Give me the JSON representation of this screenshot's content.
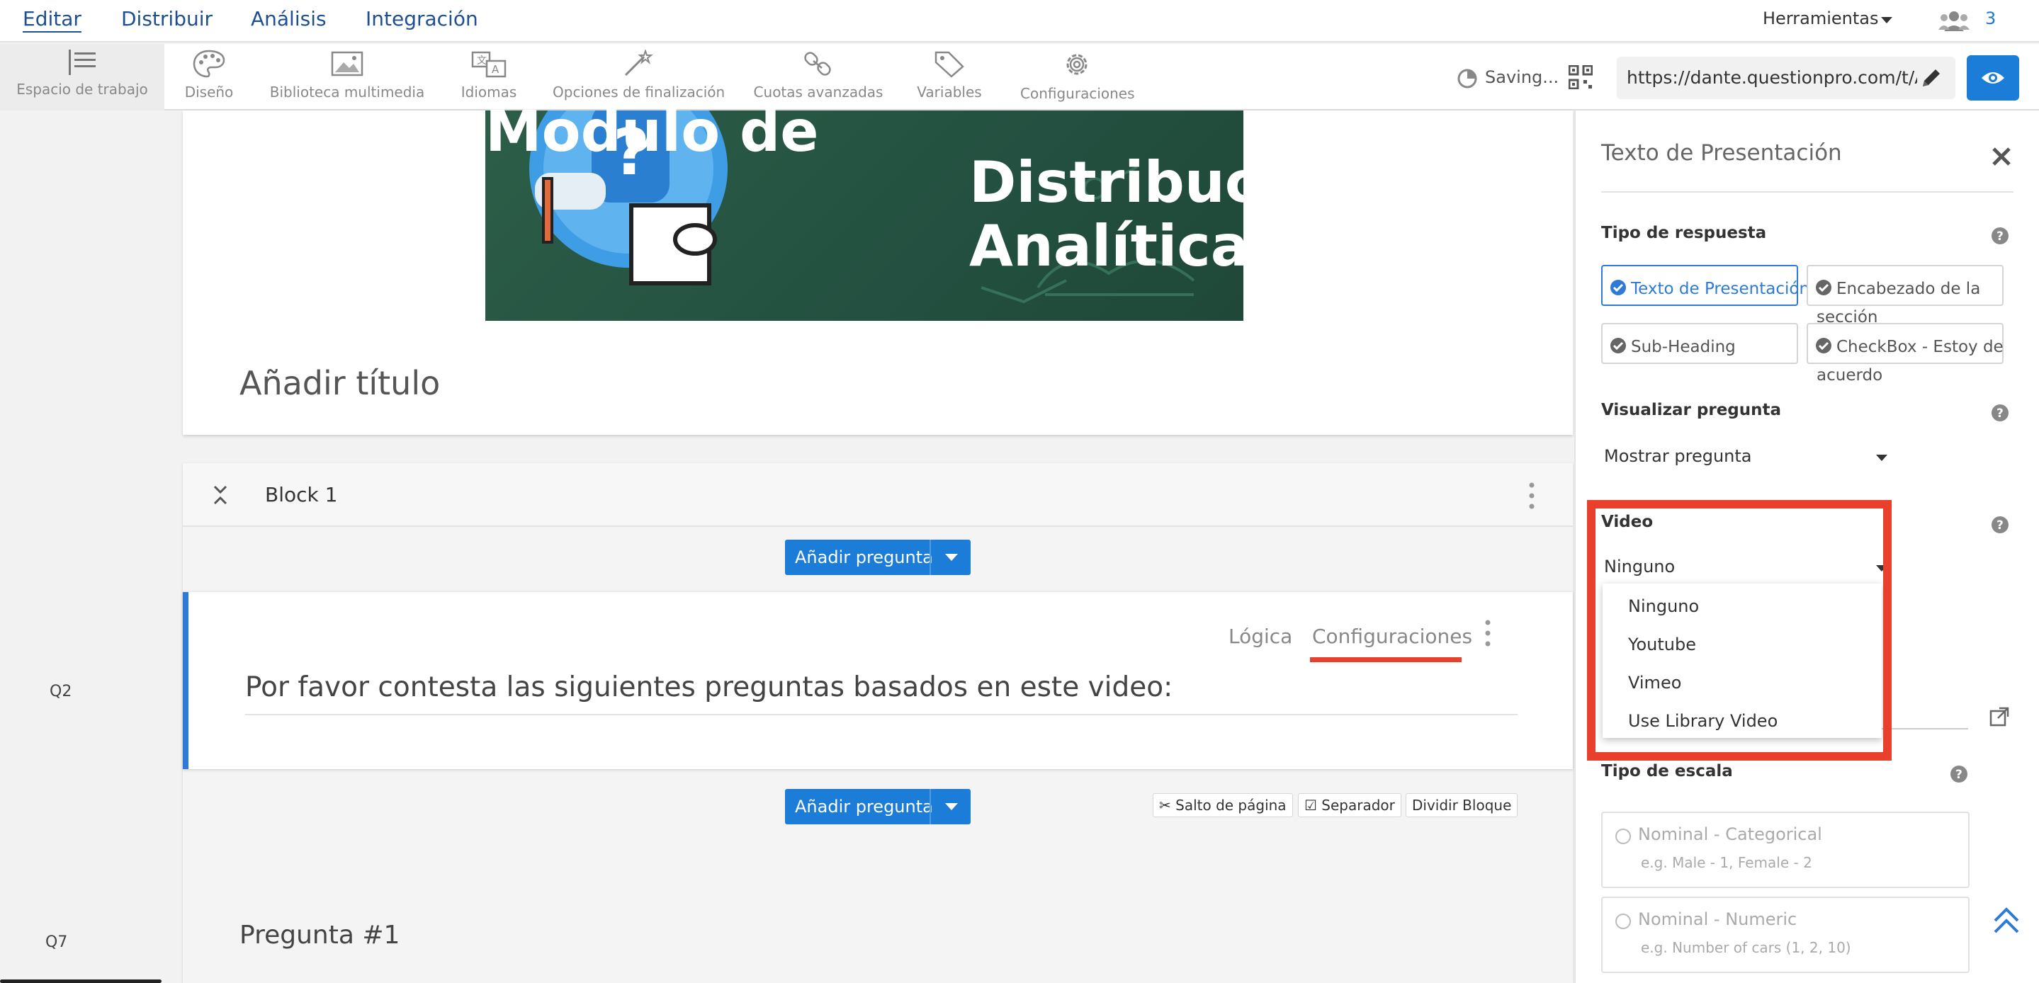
{
  "topnav": {
    "tabs": [
      "Editar",
      "Distribuir",
      "Análisis",
      "Integración"
    ],
    "tools_label": "Herramientas",
    "users_count": "3"
  },
  "toolbar": {
    "items": [
      "Espacio de trabajo",
      "Diseño",
      "Biblioteca multimedia",
      "Idiomas",
      "Opciones de finalización",
      "Cuotas avanzadas",
      "Variables",
      "Configuraciones"
    ],
    "saving": "Saving...",
    "url": "https://dante.questionpro.com/t/AS"
  },
  "gutter": {
    "q2": "Q2",
    "q7": "Q7"
  },
  "banner": {
    "lines": [
      "Modulo de",
      "Distribución y",
      "Analítica"
    ],
    "add_title": "Añadir título"
  },
  "block": {
    "title": "Block 1",
    "add_question": "Añadir pregunta",
    "question_links": [
      "Lógica",
      "Configuraciones"
    ],
    "question_text": "Por favor contesta las siguientes preguntas basados en este video:",
    "buttons": [
      "Salto de página",
      "Separador",
      "Dividir Bloque"
    ],
    "next_question": "Pregunta #1"
  },
  "panel": {
    "title": "Texto de Presentación",
    "response_type_heading": "Tipo de respuesta",
    "response_types": [
      "Texto de Presentación",
      "Encabezado de la sección",
      "Sub-Heading",
      "CheckBox - Estoy de acuerdo"
    ],
    "display_heading": "Visualizar pregunta",
    "display_value": "Mostrar pregunta",
    "video_heading": "Video",
    "video_value": "Ninguno",
    "video_options": [
      "Ninguno",
      "Youtube",
      "Vimeo",
      "Use Library Video"
    ],
    "scale_heading": "Tipo de escala",
    "scale_options": [
      {
        "title": "Nominal - Categorical",
        "subtitle": "e.g. Male - 1, Female - 2"
      },
      {
        "title": "Nominal - Numeric",
        "subtitle": "e.g. Number of cars (1, 2, 10)"
      }
    ]
  },
  "colors": {
    "accent": "#1b7dd8",
    "highlight": "#e8402c",
    "nav_text": "#1d4f91"
  }
}
